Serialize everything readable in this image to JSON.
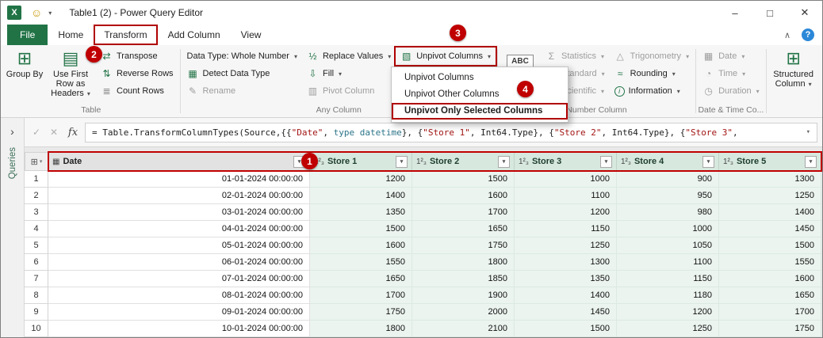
{
  "window": {
    "title": "Table1 (2) - Power Query Editor",
    "controls": {
      "minimize": "–",
      "maximize": "□",
      "close": "✕"
    }
  },
  "icons": {
    "excel": "X",
    "smiley": "☺",
    "qat_dropdown": "▾",
    "ribbon_collapse": "∧",
    "help": "?",
    "group_by": "⊞",
    "use_first_row": "▤",
    "transpose": "⇄",
    "reverse_rows": "⇅",
    "count_rows": "≣",
    "detect_data_type": "▦",
    "rename": "✎",
    "replace_values": "½",
    "fill": "⇩",
    "pivot_column": "▥",
    "unpivot_columns": "▧",
    "statistics": "Σ",
    "standard": "±",
    "scientific": "10²",
    "trigonometry": "△",
    "rounding": "≈",
    "information": "i",
    "date": "▦",
    "time": "◔",
    "duration": "◷",
    "structured_column": "⊞",
    "abc": "ABC",
    "num123": "123",
    "dropdown": "▾",
    "check": "✓",
    "cancel": "✕",
    "fx": "fx",
    "formula_expand": "▾",
    "sidebar_expand": "›",
    "table_menu": "⊞",
    "corner_sub": "▾",
    "whole_number": "1²₃",
    "calendar": "▦",
    "filter": "▾"
  },
  "tabs": {
    "file": "File",
    "items": [
      "Home",
      "Transform",
      "Add Column",
      "View"
    ]
  },
  "ribbon": {
    "table": {
      "group_label": "Table",
      "group_by": "Group By",
      "use_first_row": "Use First Row as Headers",
      "transpose": "Transpose",
      "reverse_rows": "Reverse Rows",
      "count_rows": "Count Rows"
    },
    "any_column": {
      "group_label": "Any Column",
      "data_type": "Data Type: Whole Number",
      "detect_data_type": "Detect Data Type",
      "rename": "Rename",
      "replace_values": "Replace Values",
      "fill": "Fill",
      "pivot_column": "Pivot Column",
      "unpivot_columns": "Unpivot Columns"
    },
    "number_column": {
      "group_label": "Number Column",
      "statistics": "Statistics",
      "standard": "Standard",
      "scientific": "Scientific",
      "trigonometry": "Trigonometry",
      "rounding": "Rounding",
      "information": "Information"
    },
    "datetime": {
      "group_label": "Date & Time Co...",
      "date": "Date",
      "time": "Time",
      "duration": "Duration"
    },
    "structured": {
      "label": "Structured Column"
    }
  },
  "dropdown_menu": {
    "items": [
      {
        "label": "Unpivot Columns",
        "highlighted": false
      },
      {
        "label": "Unpivot Other Columns",
        "highlighted": false
      },
      {
        "label": "Unpivot Only Selected Columns",
        "highlighted": true
      }
    ]
  },
  "formula_bar": {
    "fx": "fx",
    "tokens": [
      {
        "text": "= Table.TransformColumnTypes(Source,{{",
        "type": "plain"
      },
      {
        "text": "\"Date\"",
        "type": "string"
      },
      {
        "text": ", ",
        "type": "plain"
      },
      {
        "text": "type datetime",
        "type": "keyword"
      },
      {
        "text": "}, {",
        "type": "plain"
      },
      {
        "text": "\"Store 1\"",
        "type": "string"
      },
      {
        "text": ", Int64.Type}, {",
        "type": "plain"
      },
      {
        "text": "\"Store 2\"",
        "type": "string"
      },
      {
        "text": ", Int64.Type}, {",
        "type": "plain"
      },
      {
        "text": "\"Store 3\"",
        "type": "string"
      },
      {
        "text": ",",
        "type": "plain"
      }
    ]
  },
  "sidebar": {
    "label": "Queries"
  },
  "grid": {
    "columns": [
      {
        "name": "Date",
        "selected": false
      },
      {
        "name": "Store 1",
        "selected": true
      },
      {
        "name": "Store 2",
        "selected": true
      },
      {
        "name": "Store 3",
        "selected": true
      },
      {
        "name": "Store 4",
        "selected": true
      },
      {
        "name": "Store 5",
        "selected": true
      }
    ],
    "rows": [
      {
        "n": "1",
        "date": "01-01-2024 00:00:00",
        "values": [
          "1200",
          "1500",
          "1000",
          "900",
          "1300"
        ]
      },
      {
        "n": "2",
        "date": "02-01-2024 00:00:00",
        "values": [
          "1400",
          "1600",
          "1100",
          "950",
          "1250"
        ]
      },
      {
        "n": "3",
        "date": "03-01-2024 00:00:00",
        "values": [
          "1350",
          "1700",
          "1200",
          "980",
          "1400"
        ]
      },
      {
        "n": "4",
        "date": "04-01-2024 00:00:00",
        "values": [
          "1500",
          "1650",
          "1150",
          "1000",
          "1450"
        ]
      },
      {
        "n": "5",
        "date": "05-01-2024 00:00:00",
        "values": [
          "1600",
          "1750",
          "1250",
          "1050",
          "1500"
        ]
      },
      {
        "n": "6",
        "date": "06-01-2024 00:00:00",
        "values": [
          "1550",
          "1800",
          "1300",
          "1100",
          "1550"
        ]
      },
      {
        "n": "7",
        "date": "07-01-2024 00:00:00",
        "values": [
          "1650",
          "1850",
          "1350",
          "1150",
          "1600"
        ]
      },
      {
        "n": "8",
        "date": "08-01-2024 00:00:00",
        "values": [
          "1700",
          "1900",
          "1400",
          "1180",
          "1650"
        ]
      },
      {
        "n": "9",
        "date": "09-01-2024 00:00:00",
        "values": [
          "1750",
          "2000",
          "1450",
          "1200",
          "1700"
        ]
      },
      {
        "n": "10",
        "date": "10-01-2024 00:00:00",
        "values": [
          "1800",
          "2100",
          "1500",
          "1250",
          "1750"
        ]
      }
    ]
  },
  "badges": [
    "1",
    "2",
    "3",
    "4"
  ],
  "colors": {
    "accent_green": "#217346",
    "annotation_red": "#c00000",
    "selected_column_bg": "#ebf4ef",
    "selected_header_bg": "#d7e8df"
  }
}
